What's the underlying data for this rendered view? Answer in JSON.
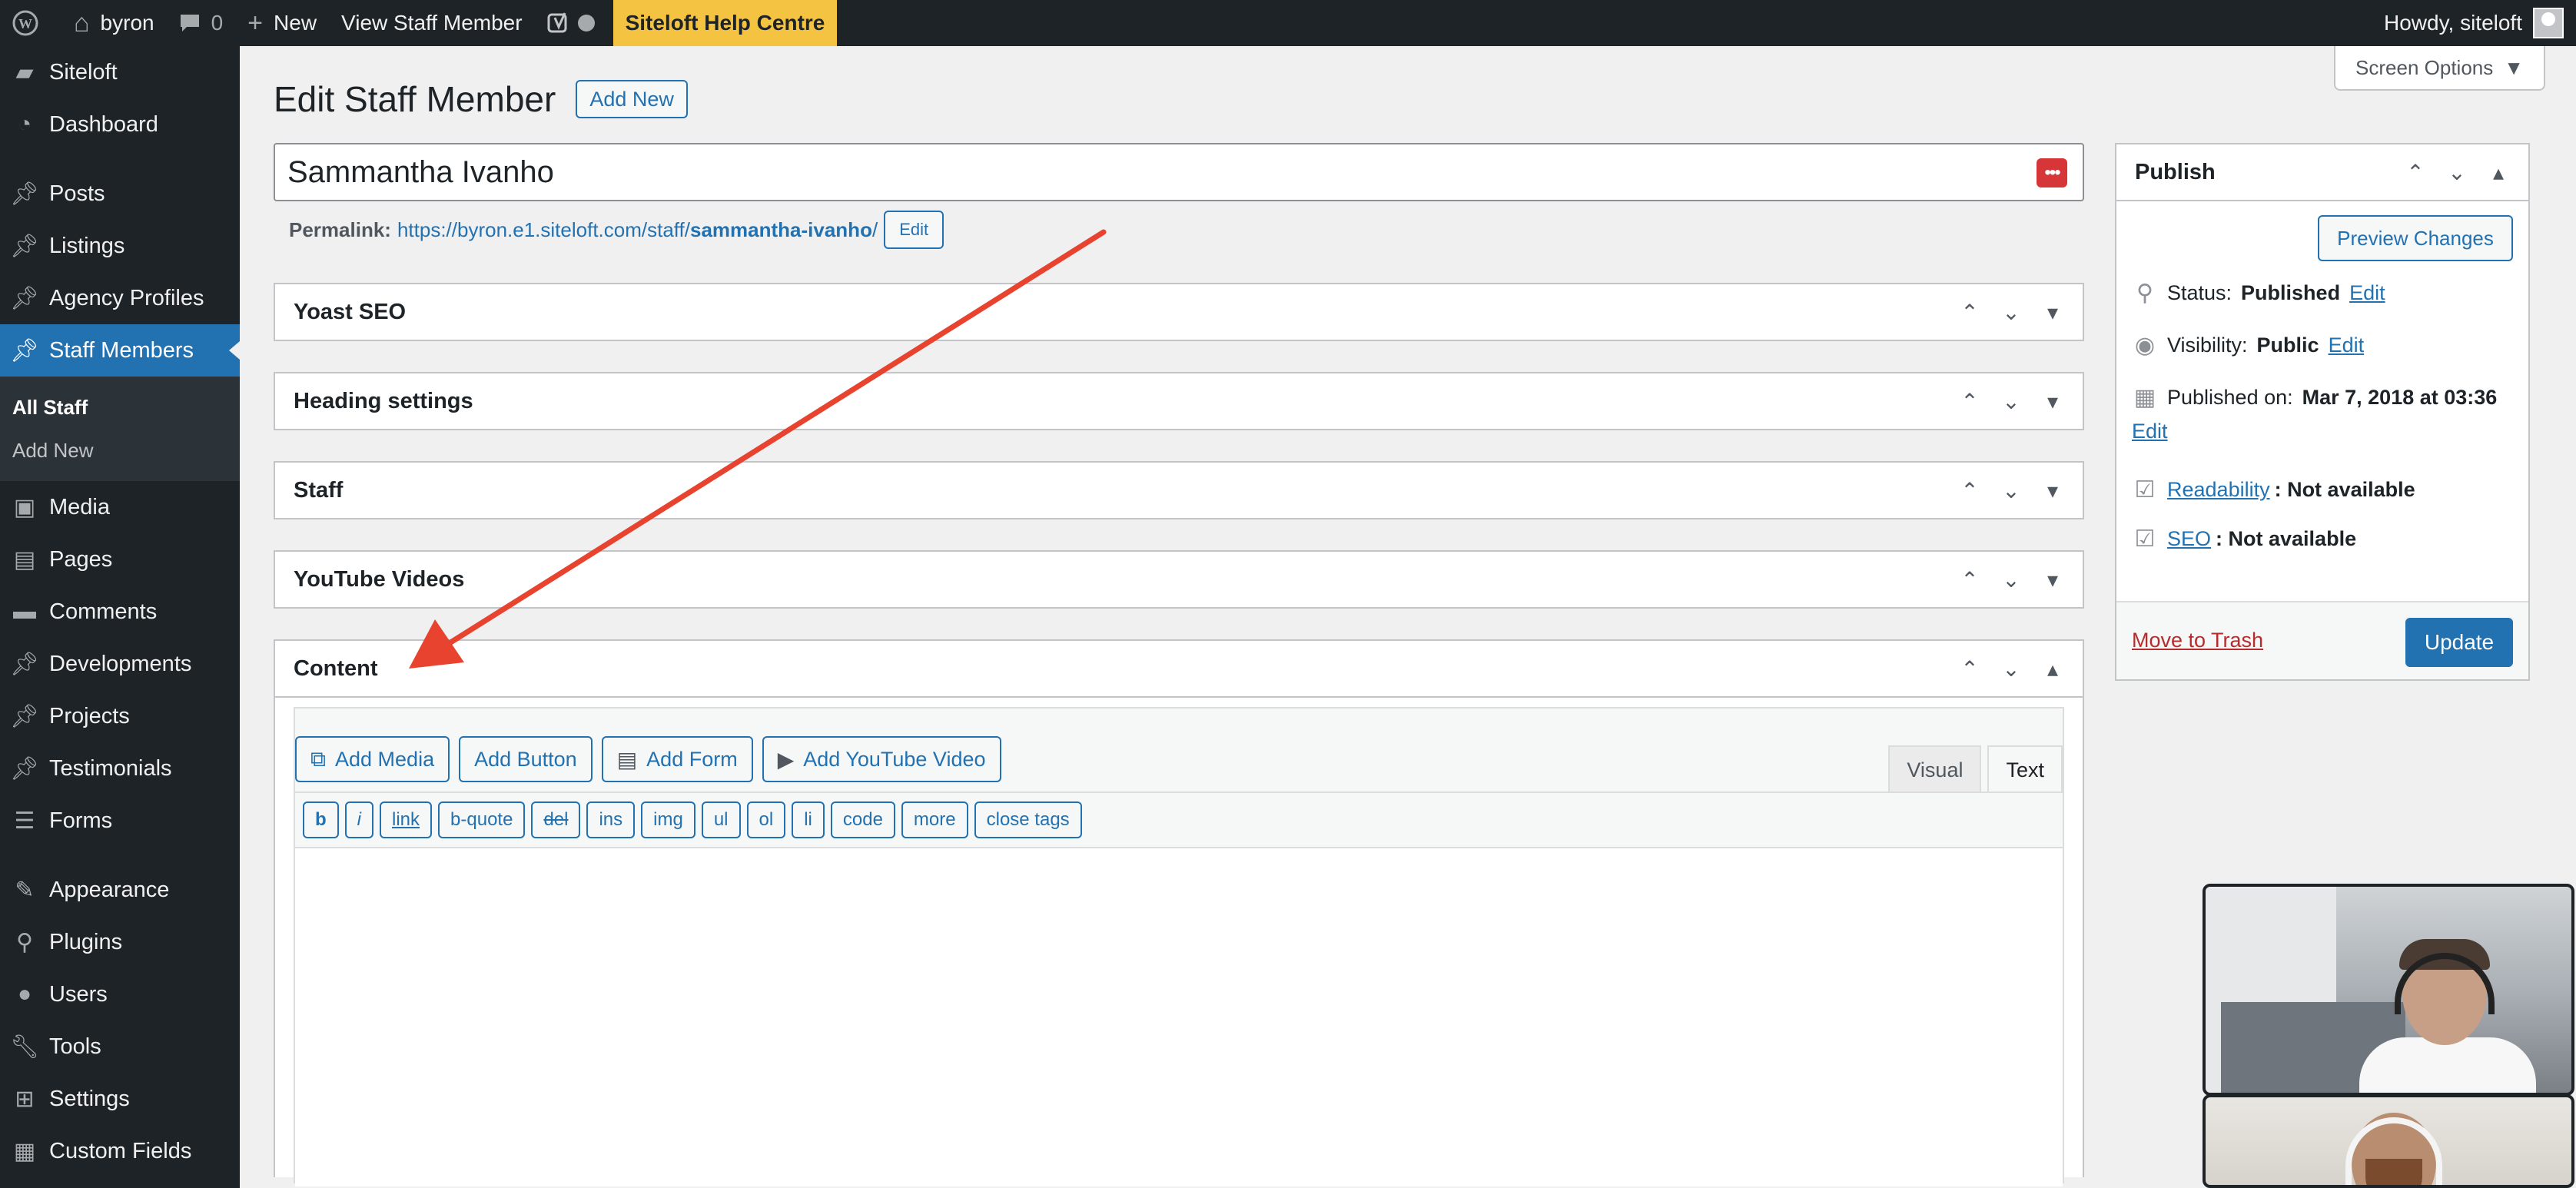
{
  "admin_bar": {
    "site_name": "byron",
    "comments_count": "0",
    "new_label": "New",
    "view_label": "View Staff Member",
    "help_label": "Siteloft Help Centre",
    "howdy": "Howdy, siteloft"
  },
  "sidebar": {
    "items": [
      {
        "label": "Siteloft",
        "icon": "siteloft-icon"
      },
      {
        "label": "Dashboard",
        "icon": "dashboard-icon"
      },
      {
        "label": "Posts",
        "icon": "pin-icon"
      },
      {
        "label": "Listings",
        "icon": "pin-icon"
      },
      {
        "label": "Agency Profiles",
        "icon": "pin-icon"
      },
      {
        "label": "Staff Members",
        "icon": "pin-icon",
        "active": true
      },
      {
        "label": "Media",
        "icon": "media-icon"
      },
      {
        "label": "Pages",
        "icon": "pages-icon"
      },
      {
        "label": "Comments",
        "icon": "comments-icon"
      },
      {
        "label": "Developments",
        "icon": "pin-icon"
      },
      {
        "label": "Projects",
        "icon": "pin-icon"
      },
      {
        "label": "Testimonials",
        "icon": "pin-icon"
      },
      {
        "label": "Forms",
        "icon": "forms-icon"
      },
      {
        "label": "Appearance",
        "icon": "appearance-icon"
      },
      {
        "label": "Plugins",
        "icon": "plugins-icon"
      },
      {
        "label": "Users",
        "icon": "users-icon"
      },
      {
        "label": "Tools",
        "icon": "tools-icon"
      },
      {
        "label": "Settings",
        "icon": "settings-icon"
      },
      {
        "label": "Custom Fields",
        "icon": "custom-fields-icon"
      }
    ],
    "submenu": [
      "All Staff",
      "Add New"
    ]
  },
  "screen_options": "Screen Options",
  "page": {
    "title": "Edit Staff Member",
    "add_new": "Add New",
    "post_title": "Sammantha Ivanho",
    "permalink_label": "Permalink:",
    "permalink_base": "https://byron.e1.siteloft.com/staff/",
    "permalink_slug": "sammantha-ivanho",
    "permalink_trailing": "/",
    "permalink_edit": "Edit"
  },
  "metaboxes": [
    "Yoast SEO",
    "Heading settings",
    "Staff",
    "YouTube Videos",
    "Content"
  ],
  "editor": {
    "media_buttons": [
      "Add Media",
      "Add Button",
      "Add Form",
      "Add YouTube Video"
    ],
    "tabs": [
      "Visual",
      "Text"
    ],
    "quicktags": [
      "b",
      "i",
      "link",
      "b-quote",
      "del",
      "ins",
      "img",
      "ul",
      "ol",
      "li",
      "code",
      "more",
      "close tags"
    ]
  },
  "publish": {
    "title": "Publish",
    "preview": "Preview Changes",
    "status_label": "Status:",
    "status_value": "Published",
    "visibility_label": "Visibility:",
    "visibility_value": "Public",
    "published_label": "Published on:",
    "published_value": "Mar 7, 2018 at 03:36",
    "edit": "Edit",
    "readability_link": "Readability",
    "readability_value": ": Not available",
    "seo_link": "SEO",
    "seo_value": ": Not available",
    "trash": "Move to Trash",
    "update": "Update"
  },
  "colors": {
    "admin_dark": "#1d2327",
    "accent": "#2271b1",
    "help_bg": "#f5c342",
    "arrow": "#e8432e",
    "trash": "#b32d2e"
  }
}
